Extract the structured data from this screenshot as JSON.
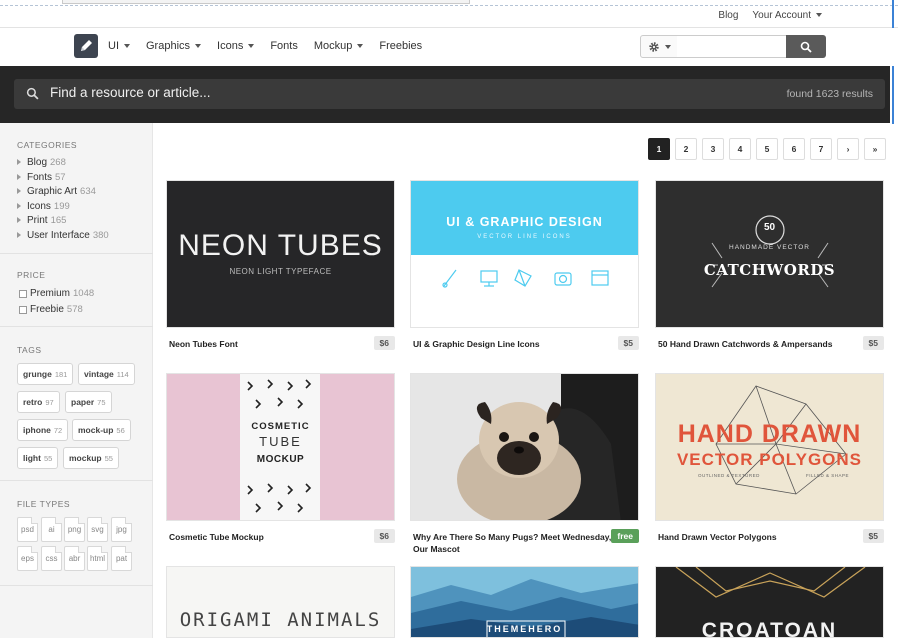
{
  "top_links": {
    "blog": "Blog",
    "account": "Your Account"
  },
  "nav": {
    "items": [
      {
        "label": "UI",
        "dropdown": true
      },
      {
        "label": "Graphics",
        "dropdown": true
      },
      {
        "label": "Icons",
        "dropdown": true
      },
      {
        "label": "Fonts",
        "dropdown": false
      },
      {
        "label": "Mockup",
        "dropdown": true
      },
      {
        "label": "Freebies",
        "dropdown": false
      }
    ],
    "search_placeholder": ""
  },
  "hero": {
    "placeholder": "Find a resource or article...",
    "count": "found 1623 results"
  },
  "sidebar": {
    "categories_title": "CATEGORIES",
    "categories": [
      {
        "label": "Blog",
        "count": "268"
      },
      {
        "label": "Fonts",
        "count": "57"
      },
      {
        "label": "Graphic Art",
        "count": "634"
      },
      {
        "label": "Icons",
        "count": "199"
      },
      {
        "label": "Print",
        "count": "165"
      },
      {
        "label": "User Interface",
        "count": "380"
      }
    ],
    "price_title": "PRICE",
    "price": [
      {
        "label": "Premium",
        "count": "1048"
      },
      {
        "label": "Freebie",
        "count": "578"
      }
    ],
    "tags_title": "TAGS",
    "tags": [
      {
        "label": "grunge",
        "count": "181"
      },
      {
        "label": "vintage",
        "count": "114"
      },
      {
        "label": "retro",
        "count": "97"
      },
      {
        "label": "paper",
        "count": "75"
      },
      {
        "label": "iphone",
        "count": "72"
      },
      {
        "label": "mock-up",
        "count": "56"
      },
      {
        "label": "light",
        "count": "55"
      },
      {
        "label": "mockup",
        "count": "55"
      }
    ],
    "filetypes_title": "FILE TYPES",
    "filetypes": [
      "psd",
      "ai",
      "png",
      "svg",
      "jpg",
      "eps",
      "css",
      "abr",
      "html",
      "pat"
    ]
  },
  "pagination": [
    "1",
    "2",
    "3",
    "4",
    "5",
    "6",
    "7",
    "›",
    "»"
  ],
  "cards": [
    {
      "title": "Neon Tubes Font",
      "price": "$6"
    },
    {
      "title": "UI & Graphic Design Line Icons",
      "price": "$5"
    },
    {
      "title": "50 Hand Drawn Catchwords & Ampersands",
      "price": "$5"
    },
    {
      "title": "Cosmetic Tube Mockup",
      "price": "$6"
    },
    {
      "title": "Why Are There So Many Pugs? Meet Wednesday, Our Mascot",
      "price": "free"
    },
    {
      "title": "Hand Drawn Vector Polygons",
      "price": "$5"
    }
  ],
  "thumbs": {
    "neon_title": "NEON TUBES",
    "neon_sub": "NEON LIGHT TYPEFACE",
    "ui_title": "UI & GRAPHIC DESIGN",
    "ui_sub": "VECTOR LINE ICONS",
    "catch_num": "50",
    "catch_top": "HANDMADE VECTOR",
    "catch_main": "CATCHWORDS",
    "tube_lines": [
      "COSMETIC",
      "TUBE",
      "MOCKUP"
    ],
    "poly_line1": "HAND DRAWN",
    "poly_line2": "VECTOR POLYGONS",
    "poly_sub": "OUTLINED & TEXTURED",
    "poly_sub2": "FILLED & SHAPE",
    "origami": "ORIGAMI ANIMALS",
    "themehero": "THEMEHERO",
    "croatoan": "CROATOAN"
  }
}
